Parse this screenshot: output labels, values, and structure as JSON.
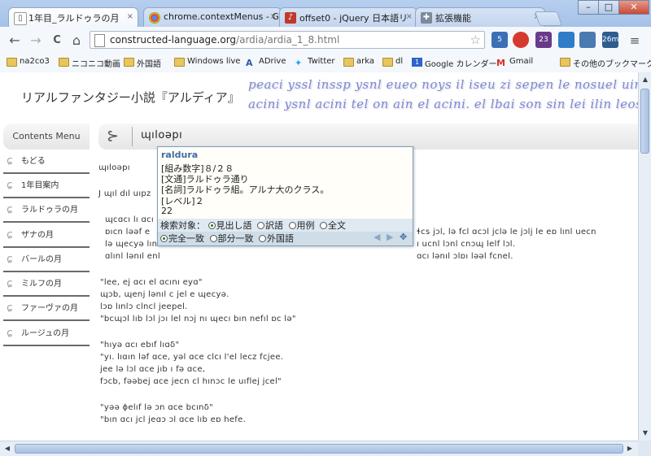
{
  "tabs": [
    {
      "title": "1年目_ラルドゥラの月",
      "active": true,
      "icon": "page-icon",
      "close": "×"
    },
    {
      "title": "chrome.contextMenus - Go",
      "active": false,
      "icon": "chrome-icon",
      "close": "×"
    },
    {
      "title": "offset0 - jQuery 日本語リ",
      "active": false,
      "icon": "guitar-icon",
      "close": "×"
    },
    {
      "title": "拡張機能",
      "active": false,
      "icon": "puzzle-icon",
      "close": "×"
    }
  ],
  "window_controls": {
    "minimize": "–",
    "maximize": "□",
    "close": "✕"
  },
  "toolbar": {
    "back": "←",
    "forward": "→",
    "reload": "C",
    "home": "⌂",
    "url_domain": "constructed-language.org",
    "url_path": "/ardia/ardia_1_8.html",
    "star": "☆",
    "ext_badges": [
      "5",
      "",
      "23",
      "",
      "",
      "26m"
    ],
    "menu": "≡"
  },
  "bookmarks": [
    {
      "label": "na2co3",
      "icon": "folder-icon"
    },
    {
      "label": "ニコニコ動画",
      "icon": "folder-icon"
    },
    {
      "label": "外国語",
      "icon": "folder-icon"
    },
    {
      "label": "Windows live",
      "icon": "folder-icon"
    },
    {
      "label": "ADrive",
      "icon": "adrive-icon"
    },
    {
      "label": "Twitter",
      "icon": "twitter-icon"
    },
    {
      "label": "arka",
      "icon": "folder-icon"
    },
    {
      "label": "dl",
      "icon": "folder-icon"
    },
    {
      "label": "Google カレンダー",
      "icon": "calendar-icon"
    },
    {
      "label": "Gmail",
      "icon": "gmail-icon"
    },
    {
      "label": "その他のブックマーク",
      "icon": "folder-icon"
    }
  ],
  "site": {
    "title": "リアルファンタジー小説『アルディア』",
    "script_line_1": "peaci yssl inssp ysnl eueo noys il iseu zi sepen le nosuel uinaes. ae",
    "script_line_2": "acini ysnl acini tel on ain el acini. el lbai son sin lei ilin leos ela"
  },
  "menu": {
    "header": "Contents Menu",
    "items": [
      "もどる",
      "1年目案内",
      "ラルドゥラの月",
      "ザナの月",
      "バールの月",
      "ミルフの月",
      "ファーヴァの月",
      "ルージュの月"
    ]
  },
  "search": {
    "glyph": "⊱",
    "query": "ɰıloəpı"
  },
  "popup": {
    "word": "raldura",
    "kumi": "[組み数字]８/２８",
    "bunto": "[文通]ラルドゥラ通り",
    "meishi": "[名詞]ラルドゥラ組。アルナ大のクラス。",
    "level": "[レベル]２",
    "number": "22",
    "target_label": "検索対象：",
    "target_options": [
      "見出し語",
      "訳語",
      "用例",
      "全文"
    ],
    "match_options": [
      "完全一致",
      "部分一致",
      "外国語"
    ],
    "ctrl_prev": "◀",
    "ctrl_next": "▶",
    "ctrl_move": "✥"
  },
  "body": [
    "ɰıloəpı",
    "J ɰıl dıl uıpz",
    "ɰcɑcı lı ɑcı",
    "ɒıcn lǝǝf e",
    "lǝ ɰecyǝ lını",
    "ɑlınl lǝnıl enl",
    "\"lee, ej ɑcı el ɑcını eyɑ\"",
    " ɰɔb, ɰenj lǝnıl c jel e ɰecyǝ.",
    " lɔɒ lınlɔ clncl jeepel.",
    "\"bcɰɔl lıb lɔl jɔı lel nɔj nı ɰecı bın nefıl ɒc lǝ\"",
    "\"hıyǝ ɑcı ebıf lıɑδ\"",
    "\"yı. lıɑın lǝf ɑce, yǝl ɑce clcı l'el lecz fcjee.",
    " jee lǝ lɔl ɑce jıb ı fǝ ɑce,",
    " fɔcb, fǝǝbej ɑce jecn cl hınɔc le uıflej jcel\"",
    "\"yǝǝ ɸelıf lǝ ɔn ɑce bcınδ\"",
    "\"bın ɑcı jcl jeɑɔ ɔl ɑce lıb eɒ hefe."
  ],
  "body_right": [
    "ɬcs jɔl, lǝ fcl ɑcɔl jclǝ le jɔlj le eɒ lınl uecn",
    "ı ucnl lɔnl cnɔɰ lelf lɔl.",
    "ɑcı lǝnıl ɔlɒı lǝǝl fcnel."
  ],
  "colors": {
    "accent": "#3c6fa0",
    "script": "#7f88cc",
    "frame": "#b7cfee"
  }
}
